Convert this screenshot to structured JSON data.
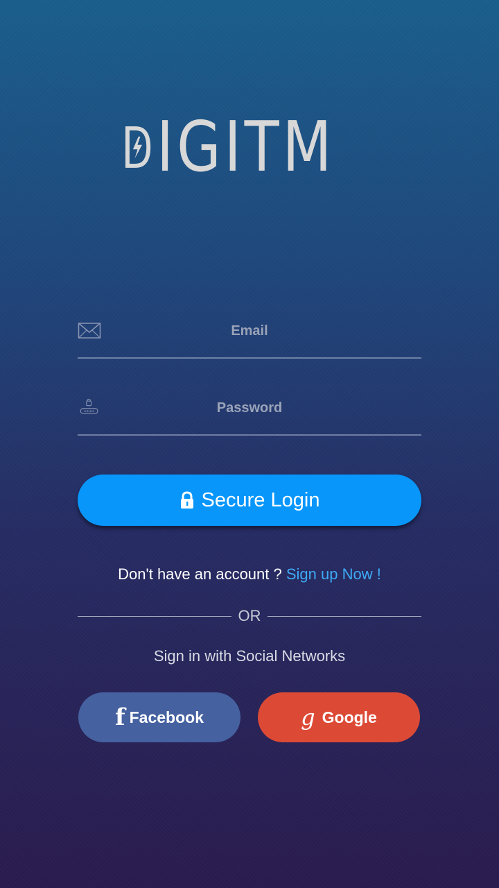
{
  "brand": {
    "logo_text": "IGITM",
    "logo_letter": "D"
  },
  "form": {
    "email_placeholder": "Email",
    "password_placeholder": "Password",
    "login_label": "Secure Login"
  },
  "signup": {
    "prompt": "Don't have an account ? ",
    "link": "Sign up Now !"
  },
  "divider": {
    "text": "OR"
  },
  "social": {
    "caption": "Sign in with Social Networks",
    "facebook_label": "Facebook",
    "facebook_icon": "f",
    "google_label": "Google",
    "google_icon": "g"
  },
  "colors": {
    "primary": "#0896fb",
    "link": "#3fa9f5",
    "facebook": "#4561a0",
    "google": "#dc4a36"
  },
  "icons": [
    "envelope-icon",
    "password-lock-icon",
    "padlock-icon",
    "facebook-icon",
    "google-icon",
    "lightning-icon"
  ]
}
